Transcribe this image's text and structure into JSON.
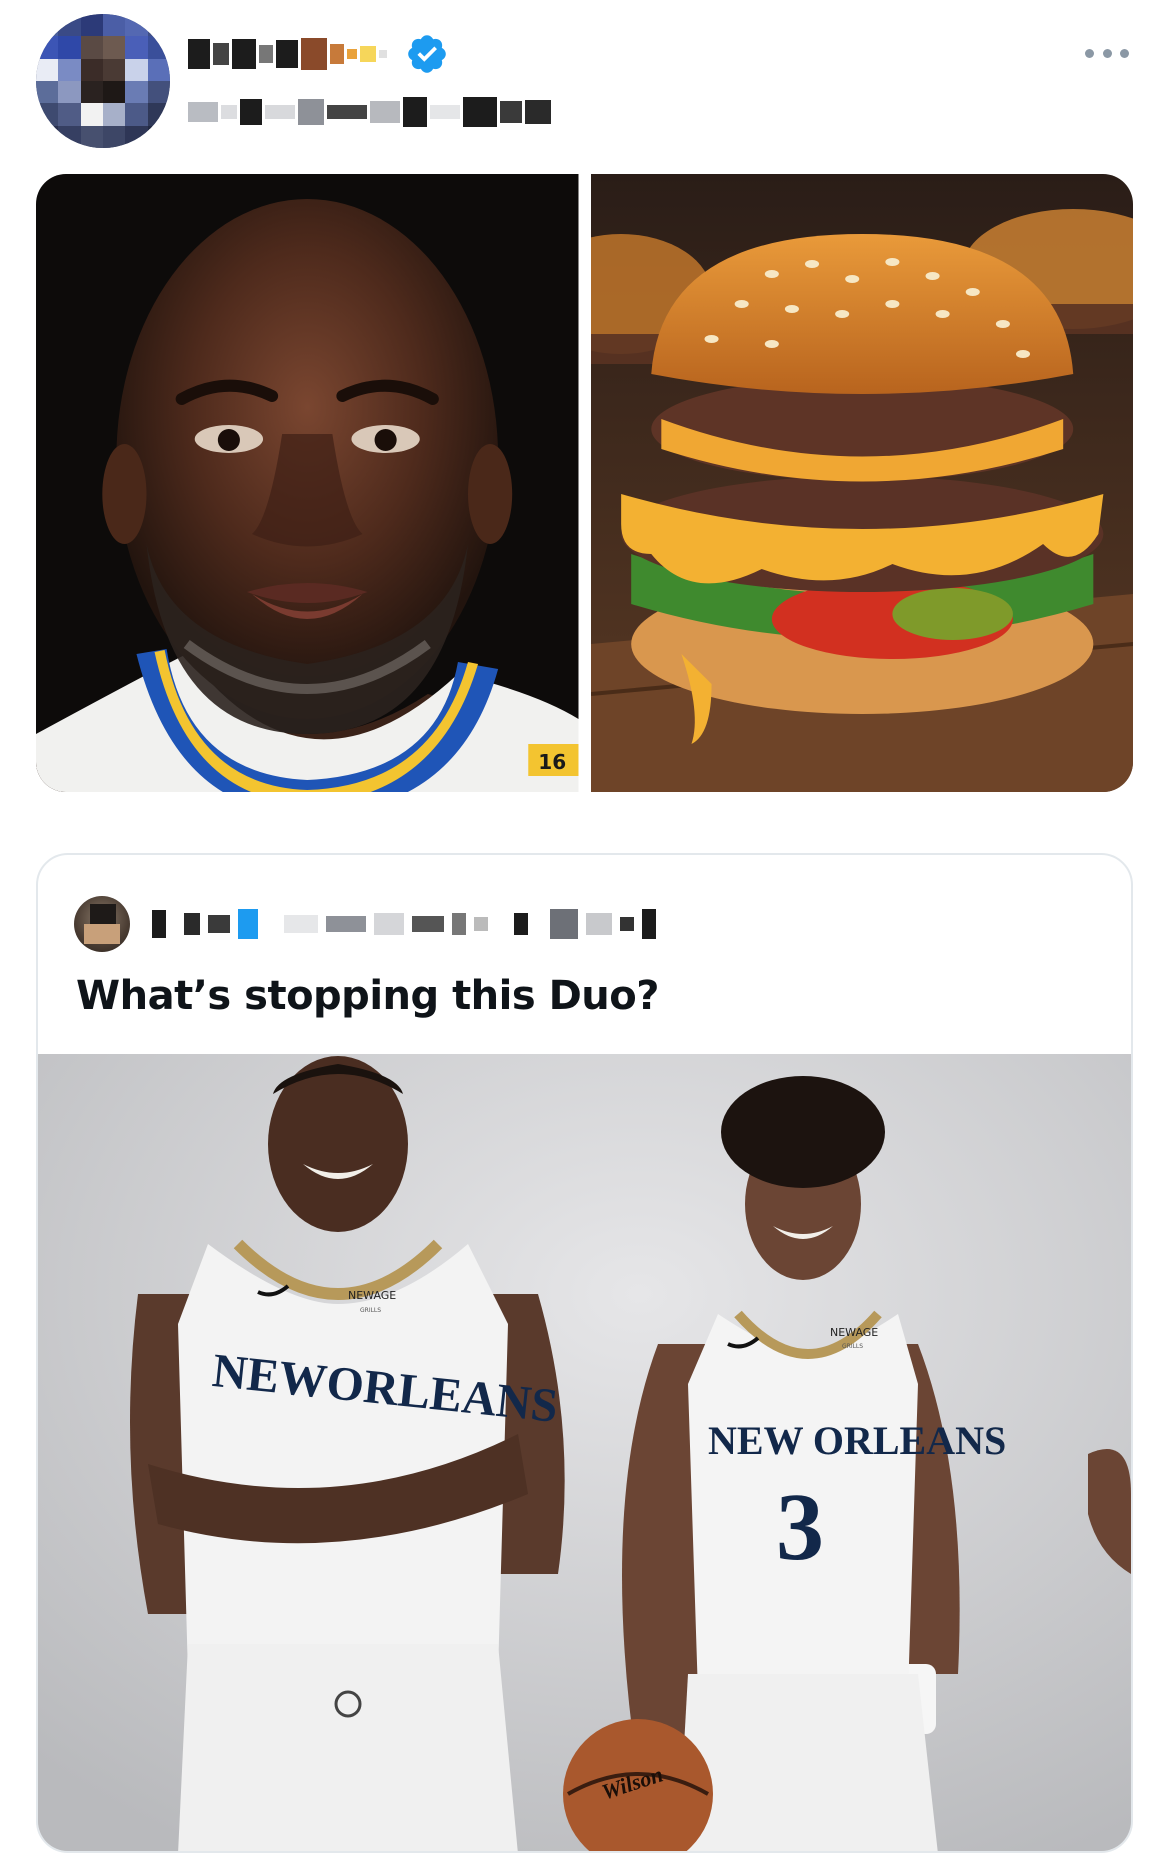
{
  "tweet": {
    "jersey_number": "16",
    "more_icon": "more-dots-icon",
    "verified_icon": "verified-badge-icon",
    "colors": {
      "verified": "#1d9bf0",
      "more": "#8b98a5",
      "text": "#0f1419",
      "card_border": "#e3e8ec"
    }
  },
  "quoted_tweet": {
    "text": "What’s stopping this Duo?",
    "media": {
      "left_jersey": {
        "sponsor": "NEWAGE",
        "sponsor_sub": "GRILLS",
        "wordmark": "NEWORLEANS"
      },
      "right_jersey": {
        "sponsor": "NEWAGE",
        "sponsor_sub": "GRILLS",
        "wordmark": "NEW ORLEANS",
        "number": "3"
      },
      "ball_brand": "Wilson"
    }
  }
}
